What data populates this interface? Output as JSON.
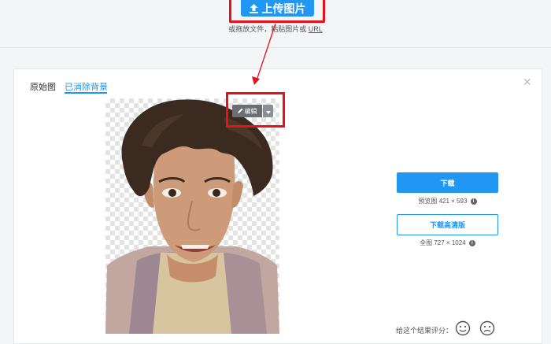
{
  "upload": {
    "button_label": "上传图片",
    "hint_before_url": "或拖放文件，粘贴图片或 ",
    "hint_url": "URL"
  },
  "tabs": [
    {
      "label": "原始图",
      "active": false
    },
    {
      "label": "已消除背景",
      "active": true
    }
  ],
  "editor": {
    "edit_label": "编辑"
  },
  "actions": {
    "download_label": "下载",
    "preview_prefix": "预览图",
    "preview_size": "421 × 593",
    "download_hd_label": "下载高清版",
    "full_prefix": "全图",
    "full_size": "727 × 1024"
  },
  "feedback": {
    "rate_label": "给这个结果评分："
  },
  "icons": {
    "upload": "upload-arrow-icon",
    "edit": "pencil-icon",
    "dropdown": "caret-down-icon",
    "info": "info-icon",
    "close": "close-icon",
    "rate_good": "smiley-face-icon",
    "rate_bad": "sad-face-icon"
  },
  "colors": {
    "accent": "#2196f3",
    "highlight": "#e8101b",
    "edit_button": "#6b6e72"
  }
}
